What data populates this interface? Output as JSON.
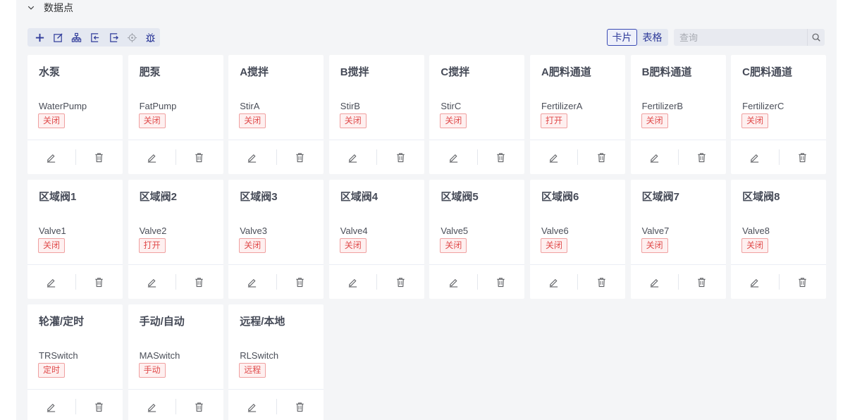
{
  "section": {
    "title": "数据点"
  },
  "toolbar": {
    "tools": [
      {
        "name": "add-icon"
      },
      {
        "name": "edit-icon"
      },
      {
        "name": "tree-icon"
      },
      {
        "name": "import-icon"
      },
      {
        "name": "export-icon"
      },
      {
        "name": "locate-icon"
      },
      {
        "name": "debug-icon"
      }
    ]
  },
  "view_toggle": {
    "card": "卡片",
    "table": "表格",
    "selected": "卡片"
  },
  "search": {
    "placeholder": "查询",
    "value": ""
  },
  "colors": {
    "accent": "#303c9a",
    "status_text": "#e04a4a",
    "status_border": "#f0a0a0",
    "status_bg": "#fef0f0"
  },
  "cards": [
    {
      "title": "水泵",
      "code": "WaterPump",
      "status": "关闭"
    },
    {
      "title": "肥泵",
      "code": "FatPump",
      "status": "关闭"
    },
    {
      "title": "A搅拌",
      "code": "StirA",
      "status": "关闭"
    },
    {
      "title": "B搅拌",
      "code": "StirB",
      "status": "关闭"
    },
    {
      "title": "C搅拌",
      "code": "StirC",
      "status": "关闭"
    },
    {
      "title": "A肥料通道",
      "code": "FertilizerA",
      "status": "打开"
    },
    {
      "title": "B肥料通道",
      "code": "FertilizerB",
      "status": "关闭"
    },
    {
      "title": "C肥料通道",
      "code": "FertilizerC",
      "status": "关闭"
    },
    {
      "title": "区域阀1",
      "code": "Valve1",
      "status": "关闭"
    },
    {
      "title": "区域阀2",
      "code": "Valve2",
      "status": "打开"
    },
    {
      "title": "区域阀3",
      "code": "Valve3",
      "status": "关闭"
    },
    {
      "title": "区域阀4",
      "code": "Valve4",
      "status": "关闭"
    },
    {
      "title": "区域阀5",
      "code": "Valve5",
      "status": "关闭"
    },
    {
      "title": "区域阀6",
      "code": "Valve6",
      "status": "关闭"
    },
    {
      "title": "区域阀7",
      "code": "Valve7",
      "status": "关闭"
    },
    {
      "title": "区域阀8",
      "code": "Valve8",
      "status": "关闭"
    },
    {
      "title": "轮灌/定时",
      "code": "TRSwitch",
      "status": "定时"
    },
    {
      "title": "手动/自动",
      "code": "MASwitch",
      "status": "手动"
    },
    {
      "title": "远程/本地",
      "code": "RLSwitch",
      "status": "远程"
    }
  ]
}
